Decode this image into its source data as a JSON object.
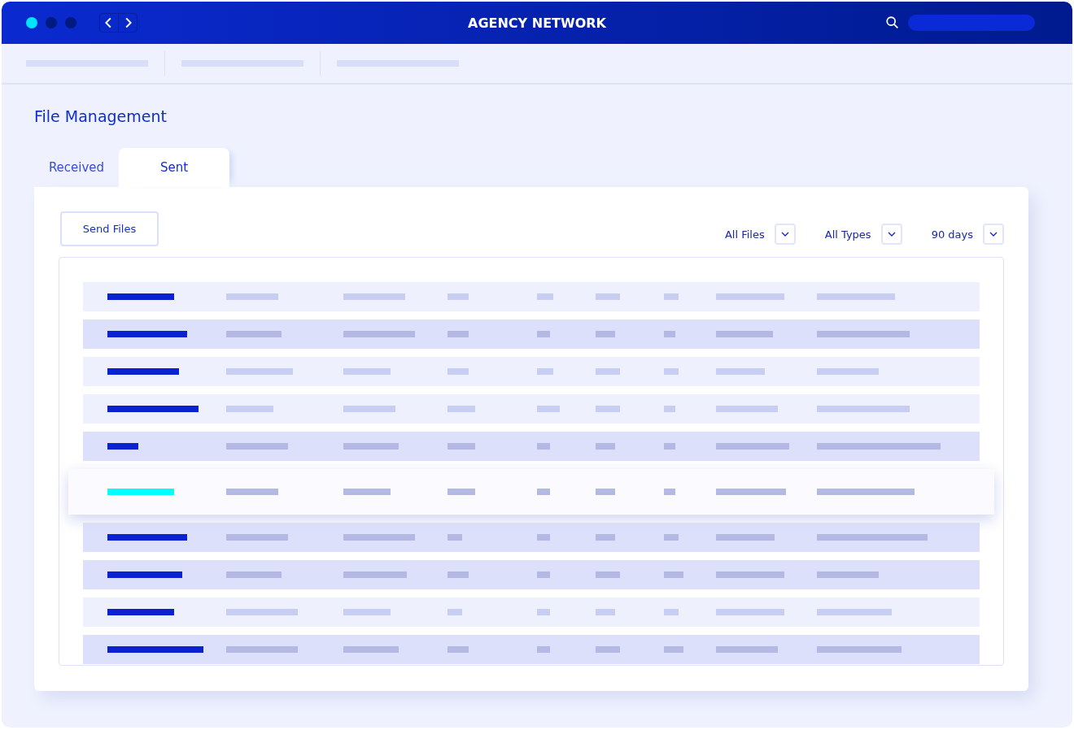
{
  "window": {
    "title": "AGENCY NETWORK"
  },
  "page": {
    "title": "File Management"
  },
  "tabs": [
    {
      "label": "Received",
      "selected": false
    },
    {
      "label": "Sent",
      "selected": true
    }
  ],
  "send_button": "Send Files",
  "filters": [
    "All Files",
    "All Types",
    "90 days"
  ],
  "table": {
    "rows": [
      {
        "shaded": false,
        "selected": false
      },
      {
        "shaded": true,
        "selected": false
      },
      {
        "shaded": false,
        "selected": false
      },
      {
        "shaded": false,
        "selected": false
      },
      {
        "shaded": true,
        "selected": false
      },
      {
        "shaded": false,
        "selected": true
      },
      {
        "shaded": true,
        "selected": false
      },
      {
        "shaded": true,
        "selected": false
      },
      {
        "shaded": false,
        "selected": false
      },
      {
        "shaded": true,
        "selected": false
      }
    ]
  }
}
